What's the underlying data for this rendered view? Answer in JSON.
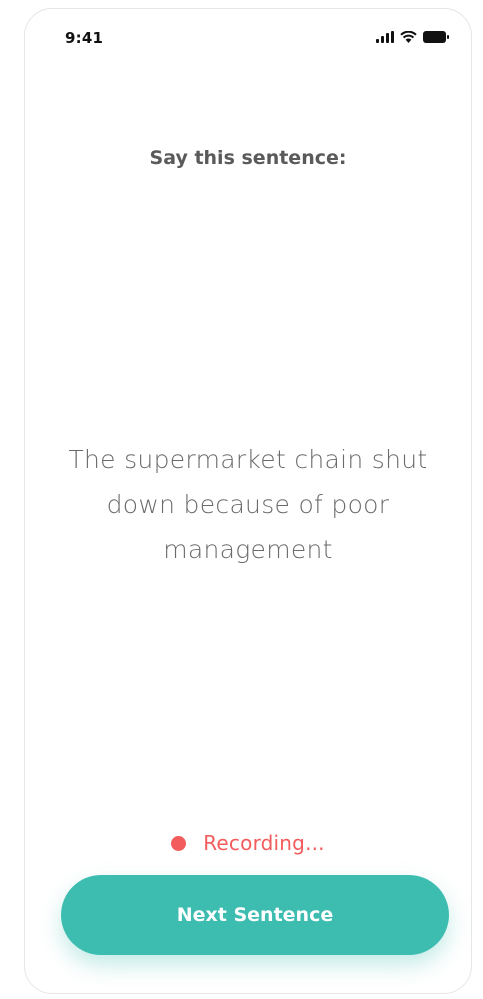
{
  "status_bar": {
    "time": "9:41",
    "icons": [
      "signal-icon",
      "wifi-icon",
      "battery-icon"
    ]
  },
  "prompt": {
    "title": "Say this sentence:",
    "sentence": "The supermarket chain shut down because of poor management"
  },
  "recording": {
    "label": "Recording...",
    "color": "#f25c5c"
  },
  "next_button": {
    "label": "Next Sentence",
    "color": "#3dbdb0"
  }
}
